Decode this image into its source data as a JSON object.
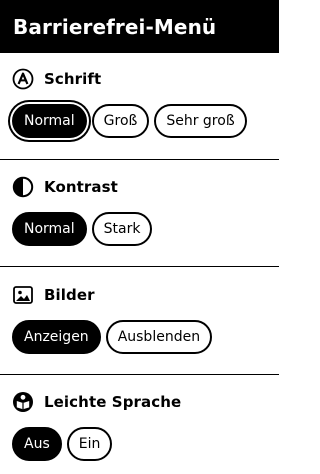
{
  "header": {
    "title": "Barrierefrei-Menü"
  },
  "sections": [
    {
      "title": "Schrift",
      "icon": "font-a-icon",
      "options": [
        "Normal",
        "Groß",
        "Sehr groß"
      ],
      "selected": "Normal"
    },
    {
      "title": "Kontrast",
      "icon": "contrast-icon",
      "options": [
        "Normal",
        "Stark"
      ],
      "selected": "Normal"
    },
    {
      "title": "Bilder",
      "icon": "image-icon",
      "options": [
        "Anzeigen",
        "Ausblenden"
      ],
      "selected": "Anzeigen"
    },
    {
      "title": "Leichte Sprache",
      "icon": "easy-language-icon",
      "options": [
        "Aus",
        "Ein"
      ],
      "selected": "Aus"
    }
  ],
  "colors": {
    "background": "#ffffff",
    "foreground": "#000000"
  }
}
